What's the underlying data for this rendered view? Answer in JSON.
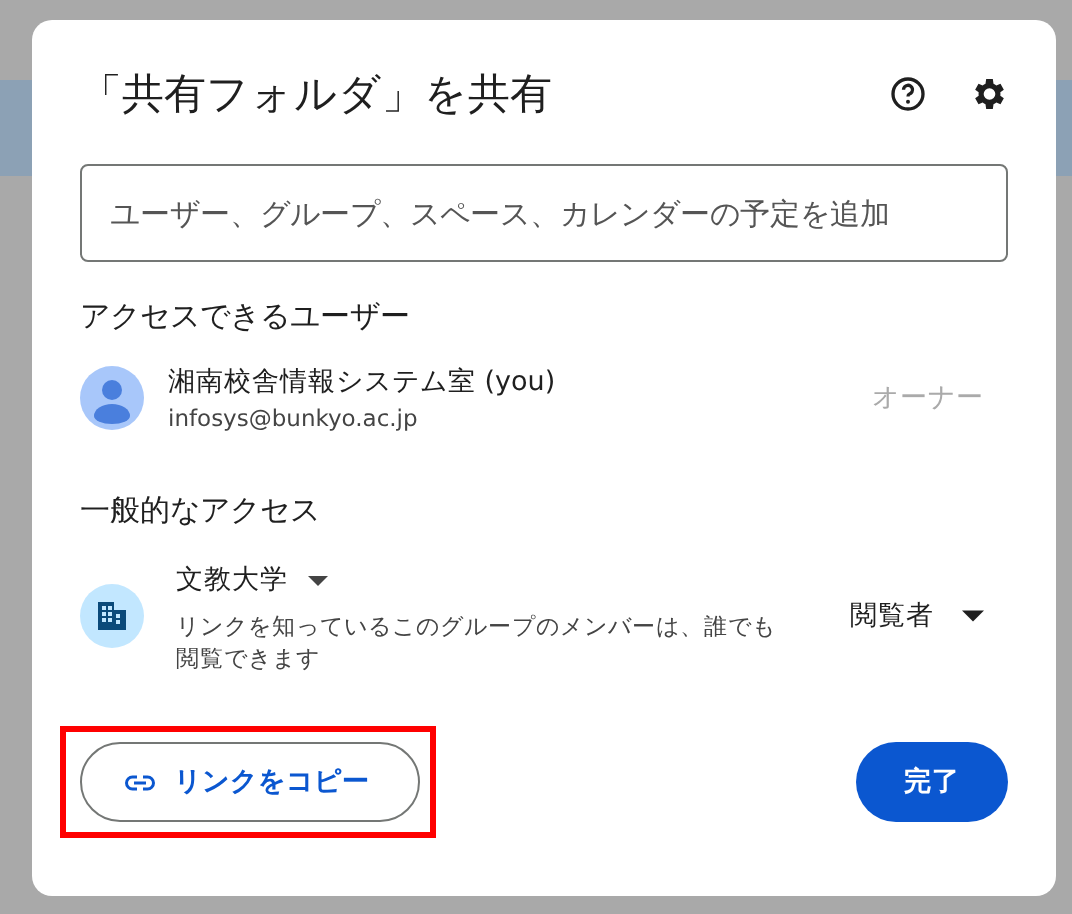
{
  "dialog": {
    "title": "「共有フォルダ」を共有"
  },
  "add_people": {
    "placeholder": "ユーザー、グループ、スペース、カレンダーの予定を追加"
  },
  "people_with_access": {
    "heading": "アクセスできるユーザー",
    "people": [
      {
        "name": "湘南校舎情報システム室 (you)",
        "email": "infosys@bunkyo.ac.jp",
        "role": "オーナー"
      }
    ]
  },
  "general_access": {
    "heading": "一般的なアクセス",
    "group": "文教大学",
    "description": "リンクを知っているこのグループのメンバーは、誰でも閲覧できます",
    "role": "閲覧者"
  },
  "footer": {
    "copy_link": "リンクをコピー",
    "copy_link_highlighted": true,
    "done": "完了"
  }
}
